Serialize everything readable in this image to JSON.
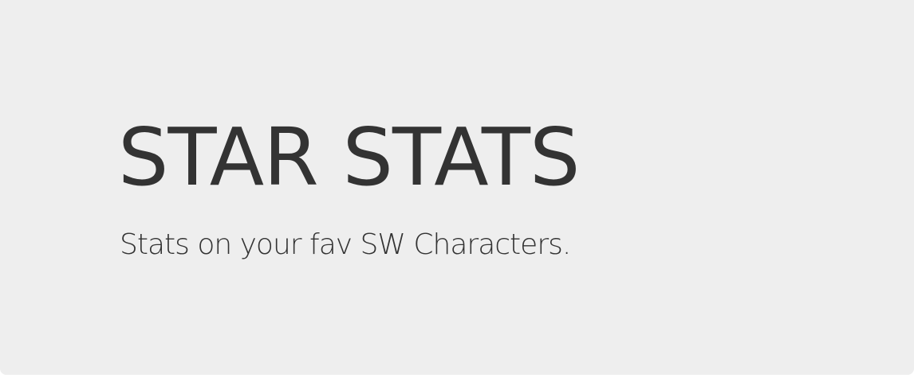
{
  "hero": {
    "title": "STAR STATS",
    "subtitle": "Stats on your fav SW Characters."
  },
  "colors": {
    "background": "#eeeeee",
    "text": "#333333"
  }
}
